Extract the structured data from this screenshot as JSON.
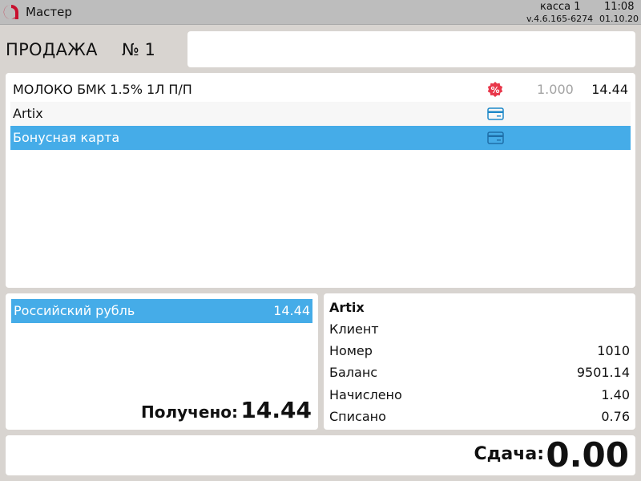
{
  "titlebar": {
    "app_title": "Мастер",
    "kassa": "касса 1",
    "time": "11:08",
    "version": "v.4.6.165-6274",
    "date": "01.10.20"
  },
  "sale": {
    "title": "ПРОДАЖА",
    "number": "№ 1"
  },
  "items": [
    {
      "label": "МОЛОКО БМК 1.5% 1Л П/П",
      "icon": "discount-icon",
      "qty": "1.000",
      "price": "14.44"
    },
    {
      "label": "Artix",
      "icon": "card-icon"
    },
    {
      "label": "Бонусная карта",
      "icon": "card-icon",
      "selected": true
    }
  ],
  "payment": {
    "currency_label": "Российский рубль",
    "currency_amount": "14.44",
    "received_label": "Получено:",
    "received_value": "14.44"
  },
  "card_info": {
    "title": "Artix",
    "client_label": "Клиент",
    "number_label": "Номер",
    "number_value": "1010",
    "balance_label": "Баланс",
    "balance_value": "9501.14",
    "accrued_label": "Начислено",
    "accrued_value": "1.40",
    "written_off_label": "Списано",
    "written_off_value": "0.76"
  },
  "change": {
    "label": "Сдача:",
    "value": "0.00"
  },
  "colors": {
    "selection": "#45ace8",
    "logo_red": "#c8102e",
    "discount_red": "#e8374a",
    "card_icon": "#1e88c8"
  }
}
